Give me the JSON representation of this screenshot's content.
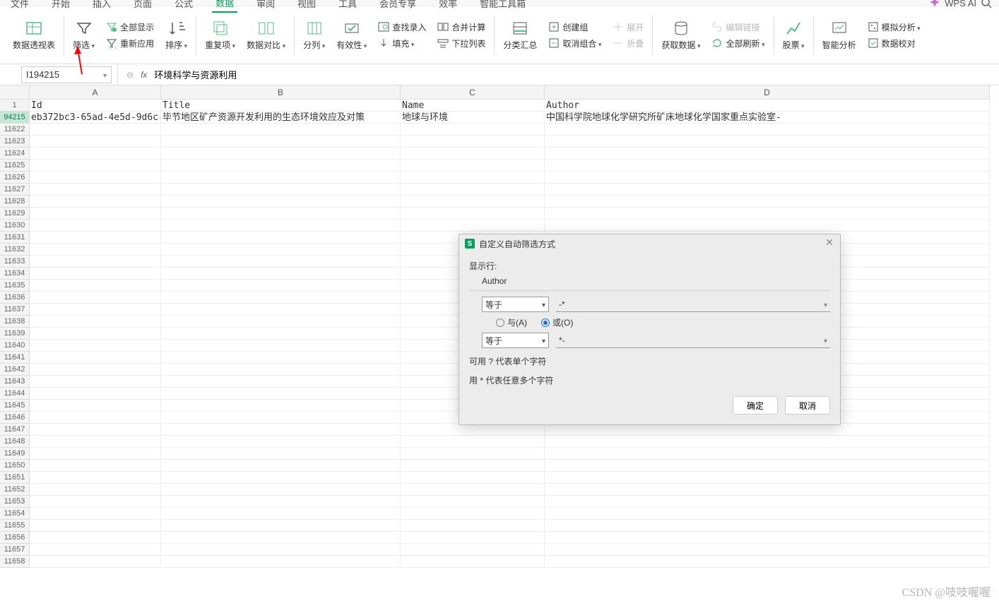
{
  "menu": {
    "file": "文件",
    "start": "开始",
    "insert": "插入",
    "page": "页面",
    "formula": "公式",
    "data": "数据",
    "review": "审阅",
    "view": "视图",
    "tools": "工具",
    "member": "会员专享",
    "effect": "效率",
    "smart": "智能工具箱",
    "wpsai": "WPS AI"
  },
  "ribbon": {
    "pivot": "数据透视表",
    "filter": "筛选",
    "showall": "全部显示",
    "reapply": "重新应用",
    "sort": "排序",
    "dup": "重复项",
    "compare": "数据对比",
    "split": "分列",
    "valid": "有效性",
    "lookup": "查找录入",
    "consol": "合并计算",
    "fill": "填充",
    "droplist": "下拉列表",
    "subtotal": "分类汇总",
    "group": "创建组",
    "ungroup": "取消组合",
    "expand": "展开",
    "collapse": "折叠",
    "getdata": "获取数据",
    "editlink": "编辑链接",
    "refresh": "全部刷新",
    "stocks": "股票",
    "analyze": "智能分析",
    "sim": "模拟分析",
    "audit": "数据校对"
  },
  "formula": {
    "cellref": "I194215",
    "fx": "fx",
    "value": "环境科学与资源利用"
  },
  "grid": {
    "cols": {
      "A": "A",
      "B": "B",
      "C": "C",
      "D": "D"
    },
    "hdr_row": "1",
    "hdr": {
      "A": "Id",
      "B": "Title",
      "C": "Name",
      "D": "Author"
    },
    "data_row": "94215",
    "data": {
      "A": "eb372bc3-65ad-4e5d-9d6c-",
      "B": "毕节地区矿产资源开发利用的生态环境效应及对策",
      "C": "地球与环境",
      "D": "中国科学院地球化学研究所矿床地球化学国家重点实验室-"
    },
    "rows": [
      "11622",
      "11623",
      "11624",
      "11625",
      "11626",
      "11627",
      "11628",
      "11629",
      "11630",
      "11631",
      "11632",
      "11633",
      "11634",
      "11635",
      "11636",
      "11637",
      "11638",
      "11639",
      "11640",
      "11641",
      "11642",
      "11643",
      "11644",
      "11645",
      "11646",
      "11647",
      "11648",
      "11649",
      "11650",
      "11651",
      "11652",
      "11653",
      "11654",
      "11655",
      "11656",
      "11657",
      "11658"
    ]
  },
  "dialog": {
    "title": "自定义自动筛选方式",
    "showrow": "显示行:",
    "field": "Author",
    "op1": "等于",
    "val1": "-*",
    "and": "与(A)",
    "or": "或(O)",
    "op2": "等于",
    "val2": "*-",
    "hint1": "可用 ? 代表单个字符",
    "hint2": "用 * 代表任意多个字符",
    "ok": "确定",
    "cancel": "取消"
  },
  "watermark": "CSDN @吱吱喔喔"
}
